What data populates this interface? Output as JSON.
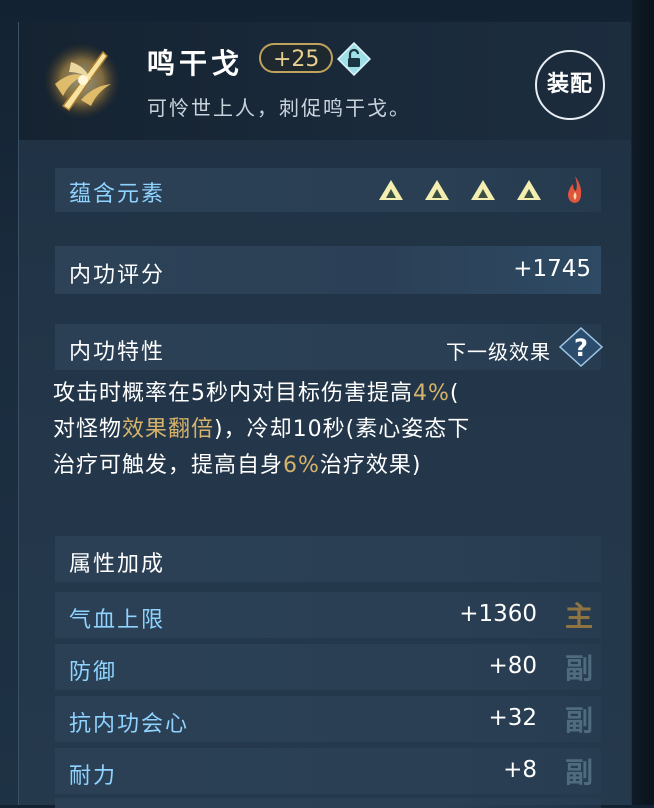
{
  "item": {
    "name": "鸣干戈",
    "level": "+25",
    "subtitle": "可怜世上人，刺促鸣干戈。",
    "equip_label": "装配"
  },
  "elements": {
    "label": "蕴含元素",
    "icons": [
      "triangle-element-icon",
      "triangle-element-icon",
      "triangle-element-icon",
      "triangle-element-icon",
      "flame-element-icon"
    ]
  },
  "score": {
    "label": "内功评分",
    "value": "+1745"
  },
  "trait": {
    "label": "内功特性",
    "next_level": "下一级效果",
    "desc_1": "攻击时概率在5秒内对目标伤害提高",
    "hl_1": "4%",
    "desc_2": "(",
    "desc_3": "对怪物",
    "hl_2": "效果翻倍",
    "desc_4": ")，冷却10秒(素心姿态下",
    "desc_5": "治疗可触发，提高自身",
    "hl_3": "6%",
    "desc_6": "治疗效果)"
  },
  "attributes": {
    "label": "属性加成",
    "stats": [
      {
        "name": "气血上限",
        "value": "+1360",
        "tag": "主"
      },
      {
        "name": "防御",
        "value": "+80",
        "tag": "副"
      },
      {
        "name": "抗内功会心",
        "value": "+32",
        "tag": "副"
      },
      {
        "name": "耐力",
        "value": "+8",
        "tag": "副"
      }
    ]
  },
  "colors": {
    "highlight": "#d6b26a",
    "stat_label": "#8fd3ff",
    "element_yellow": "#f4efb0",
    "element_fire": "#e0553e"
  }
}
